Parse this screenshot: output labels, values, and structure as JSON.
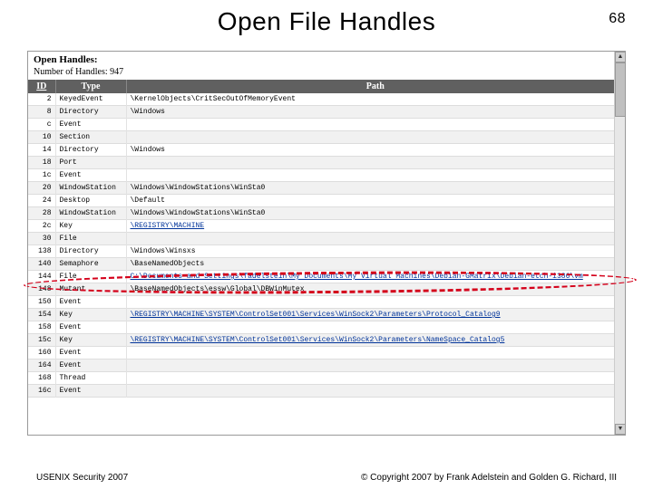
{
  "slide": {
    "title": "Open File Handles",
    "number": "68"
  },
  "app": {
    "header": "Open Handles:",
    "subheader": "Number of Handles: 947",
    "columns": {
      "id": "ID",
      "type": "Type",
      "path": "Path"
    },
    "rows": [
      {
        "id": "2",
        "type": "KeyedEvent",
        "path": "\\KernelObjects\\CritSecOutOfMemoryEvent",
        "link": false
      },
      {
        "id": "8",
        "type": "Directory",
        "path": "\\Windows",
        "link": false
      },
      {
        "id": "c",
        "type": "Event",
        "path": "",
        "link": false
      },
      {
        "id": "10",
        "type": "Section",
        "path": "",
        "link": false
      },
      {
        "id": "14",
        "type": "Directory",
        "path": "\\Windows",
        "link": false
      },
      {
        "id": "18",
        "type": "Port",
        "path": "",
        "link": false
      },
      {
        "id": "1c",
        "type": "Event",
        "path": "",
        "link": false
      },
      {
        "id": "20",
        "type": "WindowStation",
        "path": "\\Windows\\WindowStations\\WinSta0",
        "link": false
      },
      {
        "id": "24",
        "type": "Desktop",
        "path": "\\Default",
        "link": false
      },
      {
        "id": "28",
        "type": "WindowStation",
        "path": "\\Windows\\WindowStations\\WinSta0",
        "link": false
      },
      {
        "id": "2c",
        "type": "Key",
        "path": "\\REGISTRY\\MACHINE",
        "link": true
      },
      {
        "id": "30",
        "type": "File",
        "path": "",
        "link": false
      },
      {
        "id": "138",
        "type": "Directory",
        "path": "\\Windows\\Winsxs",
        "link": false
      },
      {
        "id": "140",
        "type": "Semaphore",
        "path": "\\BaseNamedObjects",
        "link": false
      },
      {
        "id": "144",
        "type": "File",
        "path": "C:\\Documents and Settings\\fadelstein\\My Documents\\My Virtual Machines\\Debian-GMatrix\\Debian-etch-i386\\vm",
        "link": true
      },
      {
        "id": "148",
        "type": "Mutant",
        "path": "\\BaseNamedObjects\\essw\\Global\\DBWinMutex",
        "link": false
      },
      {
        "id": "150",
        "type": "Event",
        "path": "",
        "link": false
      },
      {
        "id": "154",
        "type": "Key",
        "path": "\\REGISTRY\\MACHINE\\SYSTEM\\ControlSet001\\Services\\WinSock2\\Parameters\\Protocol_Catalog9",
        "link": true
      },
      {
        "id": "158",
        "type": "Event",
        "path": "",
        "link": false
      },
      {
        "id": "15c",
        "type": "Key",
        "path": "\\REGISTRY\\MACHINE\\SYSTEM\\ControlSet001\\Services\\WinSock2\\Parameters\\NameSpace_Catalog5",
        "link": true
      },
      {
        "id": "160",
        "type": "Event",
        "path": "",
        "link": false
      },
      {
        "id": "164",
        "type": "Event",
        "path": "",
        "link": false
      },
      {
        "id": "168",
        "type": "Thread",
        "path": "",
        "link": false
      },
      {
        "id": "16c",
        "type": "Event",
        "path": "",
        "link": false
      }
    ]
  },
  "annotation": {
    "highlighted_row_id": "144"
  },
  "footer": {
    "left": "USENIX Security 2007",
    "right": "© Copyright 2007 by Frank Adelstein and Golden G. Richard, III"
  }
}
